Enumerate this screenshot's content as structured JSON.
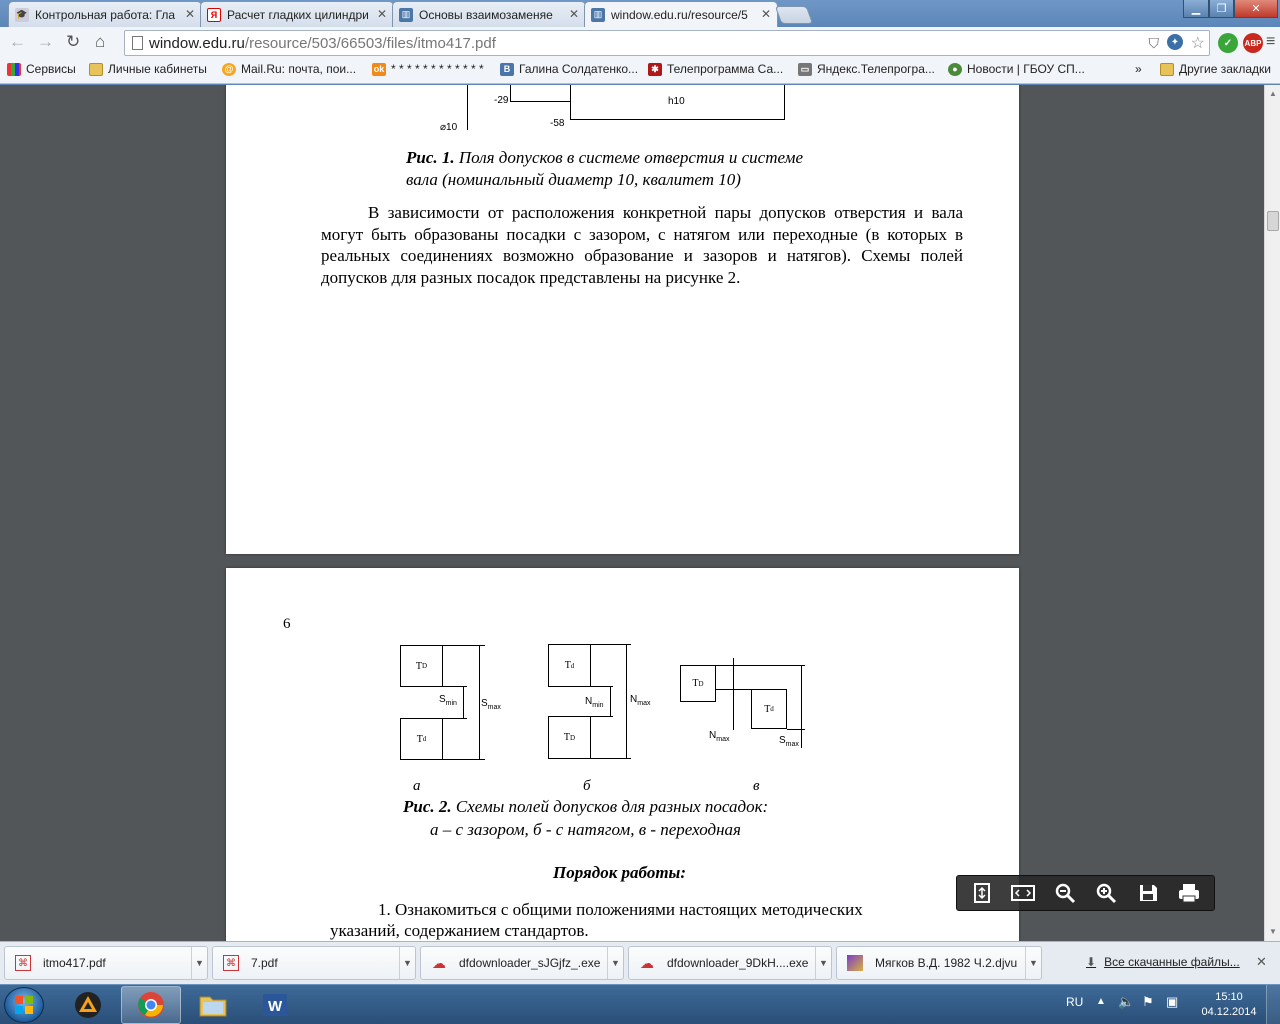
{
  "browser": {
    "tabs": [
      {
        "label": "Контрольная работа: Гла",
        "icon": "graduation-cap-icon"
      },
      {
        "label": "Расчет гладких цилиндри",
        "icon": "yandex-icon"
      },
      {
        "label": "Основы взаимозаменяе",
        "icon": "book-icon"
      },
      {
        "label": "window.edu.ru/resource/5",
        "icon": "book-icon"
      }
    ],
    "url_host": "window.edu.ru",
    "url_path": "/resource/503/66503/files/itmo417.pdf",
    "extension_abp": "ABP",
    "bookmarks": [
      {
        "label": "Сервисы"
      },
      {
        "label": "Личные кабинеты"
      },
      {
        "label": "Mail.Ru: почта, пои..."
      },
      {
        "label": "* * * * * * * * * * * *"
      },
      {
        "label": "Галина Солдатенко..."
      },
      {
        "label": "Телепрограмма Са..."
      },
      {
        "label": "Яндекс.Телепрогра..."
      },
      {
        "label": "Новости | ГБОУ СП..."
      }
    ],
    "bookmarks_more": "»",
    "other_bookmarks": "Другие закладки"
  },
  "document": {
    "page1": {
      "fig1_labels": {
        "minus29": "-29",
        "minus58": "-58",
        "h10": "h10",
        "diam10": "10"
      },
      "fig1_caption_bold": "Рис. 1.",
      "fig1_caption_line1": " Поля допусков в системе отверстия и системе",
      "fig1_caption_line2": "вала (номинальный диаметр 10, квалитет 10)",
      "paragraph": "В зависимости от расположения конкретной пары допусков отверстия и вала могут быть образованы посадки с зазором, с натягом или переходные (в которых в реальных соединениях возможно образование и зазоров и натягов). Схемы полей допусков для разных посадок представлены на рисунке 2."
    },
    "page2": {
      "page_number": "6",
      "fig2": {
        "a": {
          "top_box": "T",
          "top_sub": "D",
          "bottom_box": "T",
          "bottom_sub": "d",
          "gap_label": "S",
          "gap_sub": "min",
          "total_label": "S",
          "total_sub": "max",
          "letter": "а"
        },
        "b": {
          "top_box": "T",
          "top_sub": "d",
          "bottom_box": "T",
          "bottom_sub": "D",
          "gap_label": "N",
          "gap_sub": "min",
          "total_label": "N",
          "total_sub": "max",
          "letter": "б"
        },
        "c": {
          "left_box": "T",
          "left_sub": "D",
          "right_box": "T",
          "right_sub": "d",
          "n_label": "N",
          "n_sub": "max",
          "s_label": "S",
          "s_sub": "max",
          "letter": "в"
        }
      },
      "fig2_caption_bold": "Рис. 2.",
      "fig2_caption_line1": " Схемы полей допусков для разных посадок:",
      "fig2_caption_line2": "а – с зазором, б -  с натягом, в - переходная",
      "section_title": "Порядок работы:",
      "item1_line1": "1. Ознакомиться с общими положениями настоящих методических",
      "item1_line2": "указаний, содержанием стандартов."
    }
  },
  "pdf_toolbar": [
    "fit-page-icon",
    "fit-width-icon",
    "zoom-out-icon",
    "zoom-in-icon",
    "save-icon",
    "print-icon"
  ],
  "downloads": {
    "items": [
      {
        "name": "itmo417.pdf",
        "icon": "pdf-file-icon"
      },
      {
        "name": "7.pdf",
        "icon": "pdf-file-icon"
      },
      {
        "name": "dfdownloader_sJGjfz_.exe",
        "icon": "exe-file-icon"
      },
      {
        "name": "dfdownloader_9DkH....exe",
        "icon": "exe-file-icon"
      },
      {
        "name": "Мягков В.Д. 1982 Ч.2.djvu",
        "icon": "djvu-file-icon"
      }
    ],
    "all_downloads": "Все скачанные файлы..."
  },
  "taskbar": {
    "language": "RU",
    "time": "15:10",
    "date": "04.12.2014"
  },
  "colors": {
    "chrome_frame": "#5c86b8",
    "viewer_bg": "#525659",
    "abp_red": "#c8281e",
    "security_green": "#3aa63a"
  }
}
